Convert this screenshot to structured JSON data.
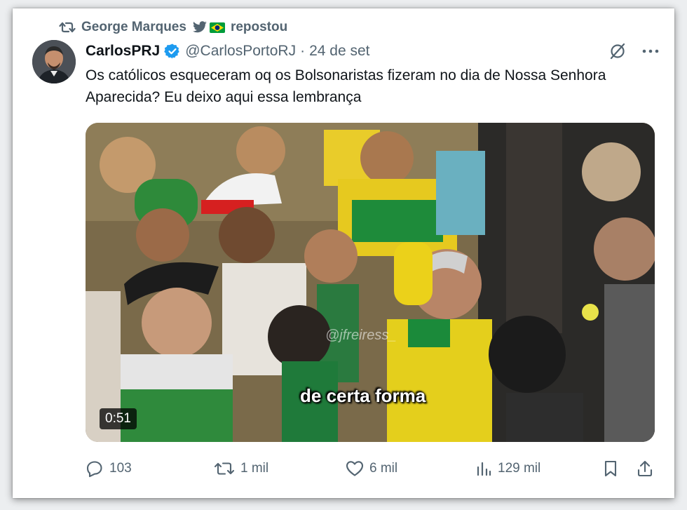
{
  "repost": {
    "icon": "repost-icon",
    "user": "George Marques",
    "suffix": "repostou"
  },
  "tweet": {
    "author_name": "CarlosPRJ",
    "verified_color": "#1d9bf0",
    "handle": "@CarlosPortoRJ",
    "separator": "·",
    "date": "24 de set",
    "text": "Os católicos esqueceram oq os Bolsonaristas fizeram no dia de Nossa Senhora Aparecida? Eu deixo aqui essa lembrança"
  },
  "media": {
    "caption": "de certa forma",
    "watermark": "@jfreiress_",
    "duration": "0:51"
  },
  "actions": {
    "replies": "103",
    "reposts": "1 mil",
    "likes": "6 mil",
    "views": "129 mil"
  },
  "colors": {
    "secondary_text": "#536471",
    "primary_text": "#0f1419",
    "accent": "#1d9bf0"
  }
}
